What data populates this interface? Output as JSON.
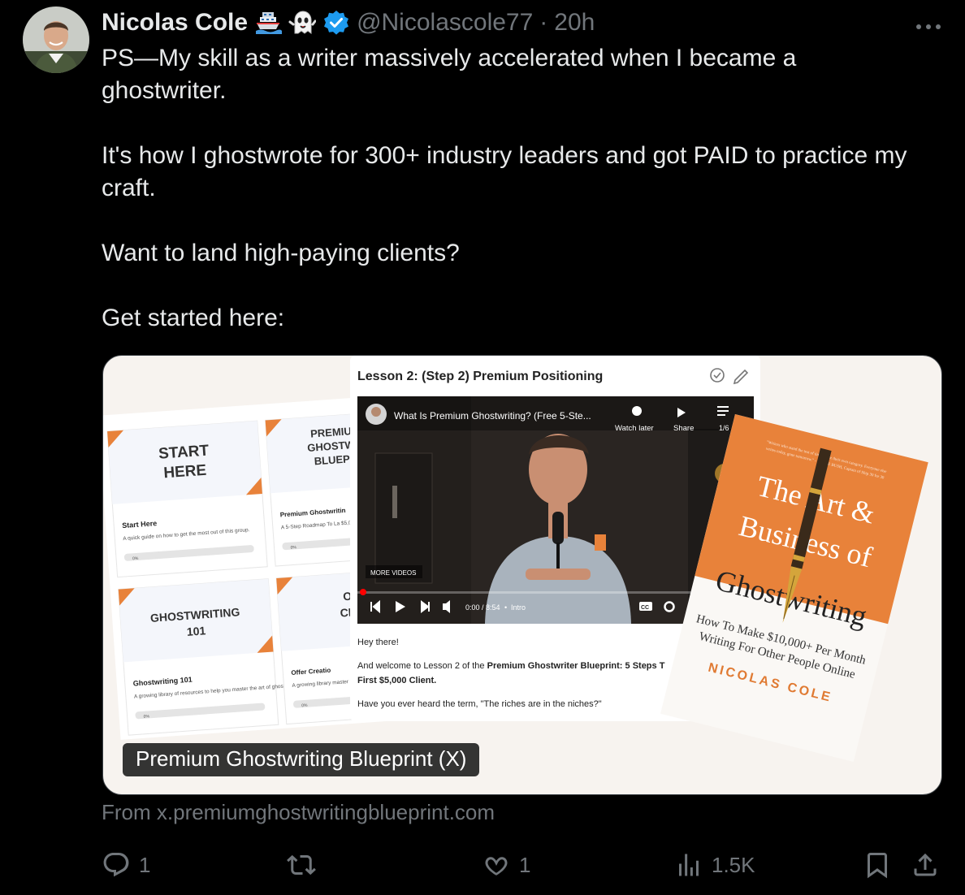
{
  "author": {
    "name": "Nicolas Cole",
    "handle": "@Nicolascole77",
    "separator": "·",
    "time": "20h",
    "emojis": [
      "ship-emoji",
      "ghost-emoji"
    ],
    "verified_badge": "verified-badge-icon"
  },
  "tweet": {
    "paragraphs": [
      "PS—My skill as a writer massively accelerated when I became a ghostwriter.",
      "It's how I ghostwrote for 300+ industry leaders and got PAID to practice my craft.",
      "Want to land high-paying clients?",
      "Get started here:"
    ]
  },
  "card": {
    "label": "Premium Ghostwriting Blueprint (X)",
    "domain_text": "From x.premiumghostwritingblueprint.com",
    "image": {
      "tiles": [
        {
          "title_lines": [
            "START",
            "HERE"
          ],
          "subtitle": "Start Here",
          "desc": "A quick guide on how to get the most out of this group.",
          "progress": "0%"
        },
        {
          "title_lines": [
            "PREMIUM",
            "GHOSTWRI",
            "BLUEPRI"
          ],
          "subtitle": "Premium Ghostwritin",
          "desc": "A 5-Step Roadmap To La $5,000 Client.",
          "progress": "0%"
        },
        {
          "title_lines": [
            "GHOSTWRITING",
            "101"
          ],
          "subtitle": "Ghostwriting 101",
          "desc": "A growing library of resources to help you master the art of ghostwriting.",
          "progress": "0%"
        },
        {
          "title_lines": [
            "OF",
            "CRE"
          ],
          "subtitle": "Offer Creatio",
          "desc": "A growing library master the art c",
          "progress": "0%"
        }
      ],
      "lesson_title": "Lesson 2: (Step 2) Premium Positioning",
      "video": {
        "title": "What Is Premium Ghostwriting? (Free 5-Ste...",
        "watch_later": "Watch later",
        "share": "Share",
        "playlist_count": "1/6",
        "more_videos": "MORE VIDEOS",
        "time": "0:00 / 8:54",
        "chapter": "Intro",
        "cc": "CC"
      },
      "lesson_body": {
        "greeting": "Hey there!",
        "line1_plain": "And welcome to Lesson 2 of the ",
        "line1_bold": "Premium Ghostwriter Blueprint: 5 Steps T",
        "line2_bold": "First $5,000 Client.",
        "line3": "Have you ever heard the term, \"The riches are in the niches?\""
      },
      "book": {
        "title_lines": [
          "The Art &",
          "Business of",
          "Ghostwriting"
        ],
        "subtitle_lines": [
          "How To Make $10,000+ Per Month",
          "Writing For Other People Online"
        ],
        "author": "NICOLAS COLE",
        "blurb_lines": [
          "\"Writers who stand the test of time create their own category. Everyone else",
          "writes today, gone tomorrow.\" - DICKIE BUSH, Captain of Ship 30 for 30"
        ],
        "colors": {
          "orange": "#e8823a",
          "cover_white": "#faf8f5",
          "author_orange": "#e07a32"
        }
      }
    }
  },
  "actions": {
    "reply": {
      "icon": "reply-icon",
      "count": "1"
    },
    "retweet": {
      "icon": "retweet-icon",
      "count": ""
    },
    "like": {
      "icon": "like-icon",
      "count": "1"
    },
    "views": {
      "icon": "views-icon",
      "count": "1.5K"
    },
    "bookmark": {
      "icon": "bookmark-icon"
    },
    "share": {
      "icon": "share-icon"
    }
  },
  "colors": {
    "background": "#000000",
    "text": "#e7e9ea",
    "muted": "#71767b",
    "verified": "#1d9bf0",
    "card_border": "#3a3f44"
  }
}
